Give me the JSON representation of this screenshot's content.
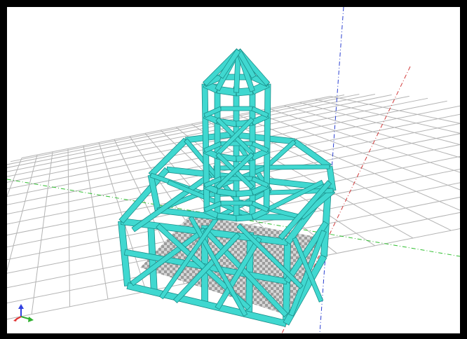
{
  "viewport": {
    "background": "#ffffff",
    "frame_color": "#000000",
    "grid_color": "#b4b4b4",
    "model_color": "#40d8d0",
    "model_edge_color": "#1a8f8a",
    "floor_pattern": "checker-gray"
  },
  "axes": {
    "x_axis_color": "#d23a3a",
    "y_axis_color": "#2fbf2f",
    "z_axis_color": "#2a3fd0",
    "style": "dash-dot"
  },
  "orientation_gizmo": {
    "icon": "xyz-triad-icon",
    "x_color": "#e03030",
    "y_color": "#30b030",
    "z_color": "#3040e0"
  },
  "model": {
    "icon": "tower-truss-structure"
  }
}
